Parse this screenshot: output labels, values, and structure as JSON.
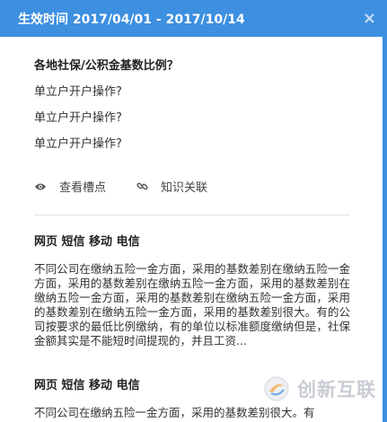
{
  "header": {
    "title": "生效时间 2017/04/01 - 2017/10/14",
    "close_label": "×"
  },
  "main": {
    "question": "各地社保/公积金基数比例？",
    "sub_questions": [
      "单立户开户操作?",
      "单立户开户操作?",
      "单立户开户操作?"
    ],
    "actions": {
      "view_notes": "查看槽点",
      "knowledge_link": "知识关联"
    }
  },
  "sections": [
    {
      "title": "网页 短信 移动 电信",
      "text": "不同公司在缴纳五险一金方面，采用的基数差别在缴纳五险一金方面，采用的基数差别在缴纳五险一金方面，采用的基数差别在缴纳五险一金方面，采用的基数差别在缴纳五险一金方面，采用的基数差别在缴纳五险一金方面，采用的基数差别很大。有的公司按要求的最低比例缴纳，有的单位以标准额度缴纳但是，社保金额其实是不能短时间提现的，并且工资..."
    },
    {
      "title": "网页 短信 移动 电信",
      "text": "不同公司在缴纳五险一金方面，采用的基数差别很大。有"
    }
  ],
  "watermark": {
    "text": "创新互联"
  },
  "colors": {
    "header": "#3d8fe0",
    "divider": "#e3e3e3"
  }
}
